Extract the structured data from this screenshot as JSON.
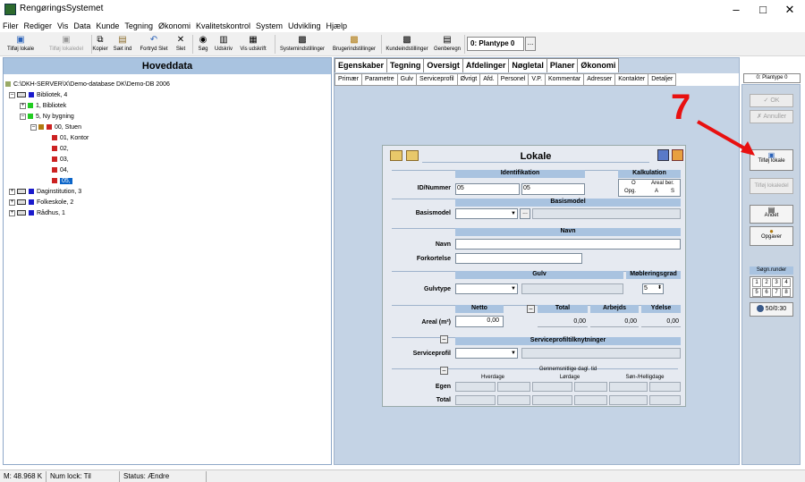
{
  "window": {
    "title": "RengøringsSystemet",
    "minimize": "–",
    "maximize": "□",
    "close": "✕"
  },
  "menu": [
    "Filer",
    "Rediger",
    "Vis",
    "Data",
    "Kunde",
    "Tegning",
    "Økonomi",
    "Kvalitetskontrol",
    "System",
    "Udvikling",
    "Hjælp"
  ],
  "toolbar": {
    "add_room": "Tilføj lokale",
    "add_room_part": "Tilføj lokaledel",
    "copy": "Kopier",
    "paste": "Sæt ind",
    "undo": "Fortryd Slet",
    "delete": "Slet",
    "search": "Søg",
    "print": "Udskriv",
    "preview": "Vis udskrift",
    "sys_settings": "Systemindstillinger",
    "user_settings": "Brugerindstillinger",
    "customer_settings": "Kundeindstillinger",
    "recalc": "Genberegn",
    "plantype": "0: Plantype 0",
    "plantype_more": "..."
  },
  "left": {
    "header": "Hoveddata",
    "path": "C:\\DKH-SERVER\\X\\Demo-database DK\\Demo-DB 2006",
    "tree": [
      {
        "label": "Bibliotek, 4",
        "expander": "–",
        "color": "#1a1acc"
      },
      {
        "label": "1, Bibliotek",
        "expander": "+",
        "color": "#22cc22"
      },
      {
        "label": "5, Ny bygning",
        "expander": "–",
        "color": "#22cc22"
      },
      {
        "label": "00, Stuen",
        "expander": "–",
        "color": "#cc2222"
      },
      {
        "label": "01, Kontor",
        "color": "#cc2222"
      },
      {
        "label": "02,",
        "color": "#cc2222"
      },
      {
        "label": "03,",
        "color": "#cc2222"
      },
      {
        "label": "04,",
        "color": "#cc2222"
      },
      {
        "label": "05,",
        "color": "#cc2222",
        "selected": true
      },
      {
        "label": "Daginstitution, 3",
        "expander": "+",
        "color": "#1a1acc"
      },
      {
        "label": "Folkeskole, 2",
        "expander": "+",
        "color": "#1a1acc"
      },
      {
        "label": "Rådhus, 1",
        "expander": "+",
        "color": "#1a1acc"
      }
    ]
  },
  "tabs1": [
    "Egenskaber",
    "Tegning",
    "Oversigt",
    "Afdelinger",
    "Nøgletal",
    "Planer",
    "Økonomi"
  ],
  "tabs2": [
    "Primær",
    "Parametre",
    "Gulv",
    "Serviceprofil",
    "Øvrigt",
    "Afd.",
    "Personel",
    "V.P.",
    "Kommentar",
    "Adresser",
    "Kontakter",
    "Detaljer"
  ],
  "card": {
    "title": "Lokale",
    "identifikation": "Identifikation",
    "kalkulation": "Kalkulation",
    "kalk_o": "O",
    "kalk_areal": "Areal ber.",
    "kalk_opg": "Opg.",
    "kalk_a": "A",
    "kalk_s": "S",
    "id_label": "ID/Nummer",
    "id1": "05",
    "id2": "05",
    "basismodel_bar": "Basismodel",
    "basismodel_label": "Basismodel",
    "dots": "...",
    "navn_bar": "Navn",
    "navn_label": "Navn",
    "forkortelse_label": "Forkortelse",
    "gulv_bar": "Gulv",
    "moebl_bar": "Møbleringsgrad",
    "gulvtype_label": "Gulvtype",
    "moebl_val": "5",
    "netto": "Netto",
    "total": "Total",
    "arbejds": "Arbejds",
    "ydelse": "Ydelse",
    "minus": "–",
    "areal_label": "Areal (m²)",
    "netto_val": "0,00",
    "total_val": "0,00",
    "arbejds_val": "0,00",
    "ydelse_val": "0,00",
    "service_bar": "Serviceprofiltilknytninger",
    "service_label": "Serviceprofil",
    "gen_tid": "Gennemsnitlige dagl. tid",
    "hverdage": "Hverdage",
    "loerdage": "Lørdage",
    "soen": "Søn-/Helligdage",
    "egen": "Egen",
    "total_row": "Total"
  },
  "right": {
    "plantype": "0: Plantype 0",
    "ok": "OK",
    "cancel": "Annuller",
    "add_room": "Tilføj lokale",
    "add_part": "Tilføj lokaledel",
    "other": "Andet",
    "tasks": "Opgaver",
    "rounds_label": "Søgn.runder",
    "rounds": [
      "1",
      "2",
      "3",
      "4",
      "5",
      "6",
      "7",
      "8"
    ],
    "rounds_value": "50/0:30"
  },
  "annotation": {
    "number": "7",
    "color": "#e81010"
  },
  "status": {
    "memory": "M: 48.968 K",
    "numlock": "Num lock: Til",
    "status": "Status: Ændre"
  }
}
